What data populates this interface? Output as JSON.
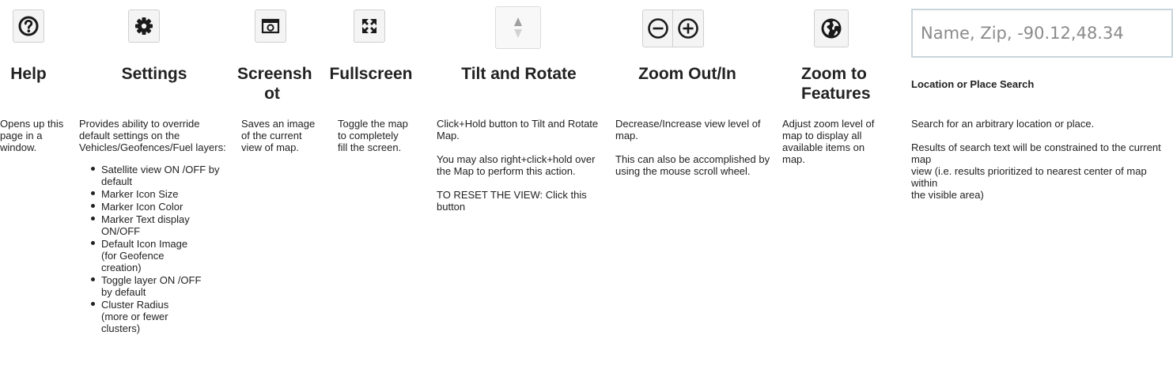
{
  "help": {
    "title": "Help",
    "desc": "Opens up this page in a window."
  },
  "settings": {
    "title": "Settings",
    "desc": "Provides ability to override default settings on the Vehicles/Geofences/Fuel layers:",
    "items": [
      "Satellite view ON /OFF by default",
      "Marker Icon Size",
      "Marker Icon Color",
      "Marker Text display ON/OFF",
      "Default Icon Image (for Geofence creation)",
      "Toggle layer ON /OFF by default",
      "Cluster Radius (more or fewer clusters)"
    ]
  },
  "screenshot": {
    "title_line1": "Screensh",
    "title_line2": "ot",
    "desc": "Saves an image of the current view of map."
  },
  "fullscreen": {
    "title": "Fullscreen",
    "desc": "Toggle the map to completely fill the screen."
  },
  "tilt": {
    "title": "Tilt and Rotate",
    "desc1": "Click+Hold button to Tilt and Rotate Map.",
    "desc2": "You may also right+click+hold over the Map to perform this action.",
    "desc3": "TO RESET THE VIEW: Click this button"
  },
  "zoom": {
    "title": "Zoom Out/In",
    "desc1": "Decrease/Increase view level of map.",
    "desc2": "This can also be accomplished by using the mouse scroll wheel."
  },
  "zoom_features": {
    "title_line1": "Zoom to",
    "title_line2": "Features",
    "desc": "Adjust zoom level of map to display all available items on map."
  },
  "search": {
    "placeholder": "Name, Zip, -90.12,48.34",
    "title": "Location or Place Search",
    "desc1": "Search for an arbitrary location or place.",
    "desc2_l1": "Results of search text will be constrained to the current map",
    "desc2_l2": "view (i.e. results prioritized to nearest center of map within",
    "desc2_l3": "the visible area)"
  }
}
